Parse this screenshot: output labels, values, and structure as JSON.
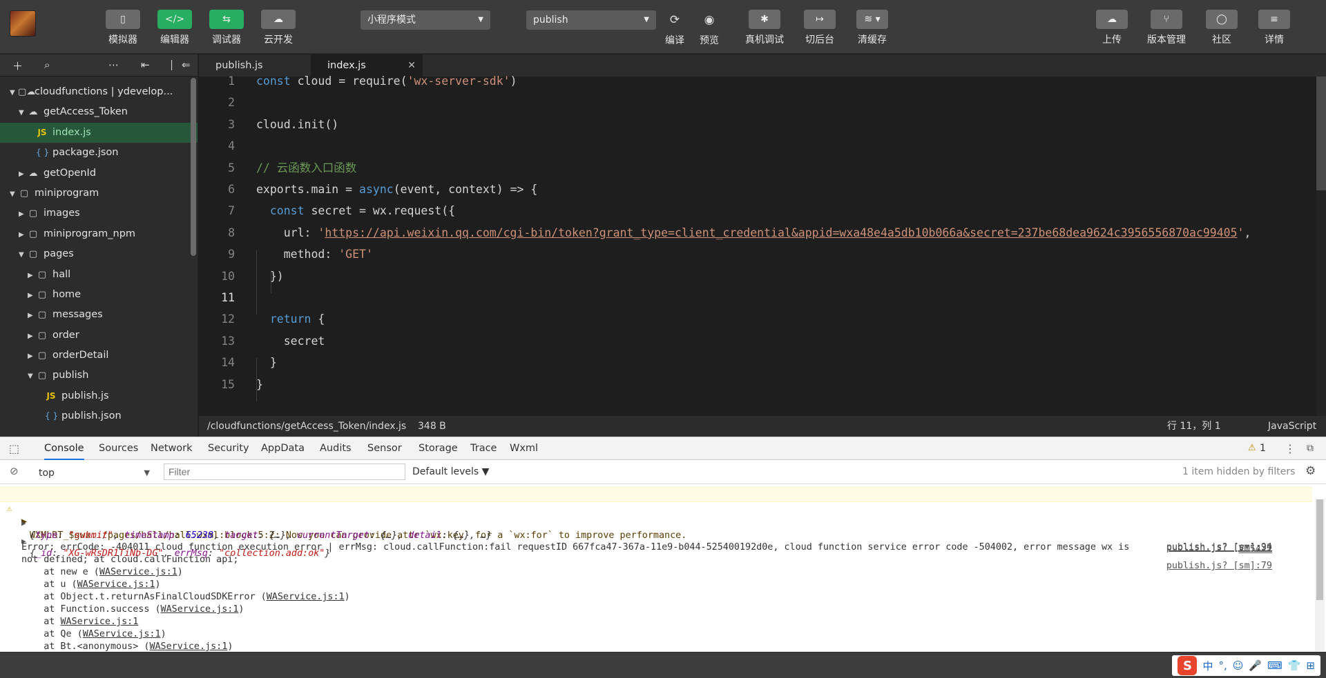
{
  "toolbar": {
    "left_buttons": [
      {
        "label": "模拟器",
        "icon": "phone-icon"
      },
      {
        "label": "编辑器",
        "icon": "code-icon"
      },
      {
        "label": "调试器",
        "icon": "debug-icon"
      },
      {
        "label": "云开发",
        "icon": "cloud-dev-icon"
      }
    ],
    "mode_select": "小程序模式",
    "compile_select": "publish",
    "action_buttons": [
      {
        "label": "编译",
        "icon": "refresh-icon"
      },
      {
        "label": "预览",
        "icon": "eye-icon"
      },
      {
        "label": "真机调试",
        "icon": "bug-icon"
      },
      {
        "label": "切后台",
        "icon": "switch-icon"
      },
      {
        "label": "清缓存",
        "icon": "layers-icon"
      }
    ],
    "right_buttons": [
      {
        "label": "上传",
        "icon": "upload-cloud-icon"
      },
      {
        "label": "版本管理",
        "icon": "branch-icon"
      },
      {
        "label": "社区",
        "icon": "chat-icon"
      },
      {
        "label": "详情",
        "icon": "menu-icon"
      }
    ]
  },
  "explorer": {
    "tree": [
      {
        "label": "cloudfunctions | ydevelop...",
        "type": "cloud-root",
        "depth": 0,
        "arrow": "▼"
      },
      {
        "label": "getAccess_Token",
        "type": "cloud",
        "depth": 1,
        "arrow": "▼"
      },
      {
        "label": "index.js",
        "type": "js",
        "depth": 2,
        "arrow": "",
        "active": true
      },
      {
        "label": "package.json",
        "type": "json",
        "depth": 2,
        "arrow": ""
      },
      {
        "label": "getOpenId",
        "type": "cloud",
        "depth": 1,
        "arrow": "▶"
      },
      {
        "label": "miniprogram",
        "type": "folder",
        "depth": 0,
        "arrow": "▼"
      },
      {
        "label": "images",
        "type": "folder",
        "depth": 1,
        "arrow": "▶"
      },
      {
        "label": "miniprogram_npm",
        "type": "folder",
        "depth": 1,
        "arrow": "▶"
      },
      {
        "label": "pages",
        "type": "folder",
        "depth": 1,
        "arrow": "▼"
      },
      {
        "label": "hall",
        "type": "folder",
        "depth": 2,
        "arrow": "▶"
      },
      {
        "label": "home",
        "type": "folder",
        "depth": 2,
        "arrow": "▶"
      },
      {
        "label": "messages",
        "type": "folder",
        "depth": 2,
        "arrow": "▶"
      },
      {
        "label": "order",
        "type": "folder",
        "depth": 2,
        "arrow": "▶"
      },
      {
        "label": "orderDetail",
        "type": "folder",
        "depth": 2,
        "arrow": "▶"
      },
      {
        "label": "publish",
        "type": "folder",
        "depth": 2,
        "arrow": "▼"
      },
      {
        "label": "publish.js",
        "type": "js",
        "depth": 3,
        "arrow": ""
      },
      {
        "label": "publish.json",
        "type": "json",
        "depth": 3,
        "arrow": ""
      }
    ]
  },
  "tabs": [
    {
      "label": "publish.js",
      "active": false
    },
    {
      "label": "index.js",
      "active": true,
      "close": "✕"
    }
  ],
  "editor": {
    "current_line": 11,
    "lines": [
      {
        "n": "1",
        "html": "<span class=\"kw\">const</span> cloud = require(<span class=\"str\">'wx-server-sdk'</span>)"
      },
      {
        "n": "2",
        "html": ""
      },
      {
        "n": "3",
        "html": "cloud.init()"
      },
      {
        "n": "4",
        "html": ""
      },
      {
        "n": "5",
        "html": "<span class=\"cm\">// 云函数入口函数</span>"
      },
      {
        "n": "6",
        "html": "exports.main = <span class=\"kw\">async</span>(event, context) =&gt; {"
      },
      {
        "n": "7",
        "html": "  <span class=\"kw\">const</span> secret = wx.request({"
      },
      {
        "n": "8",
        "html": "    url: <span class=\"str\">'</span><span class=\"url\">https://api.weixin.qq.com/cgi-bin/token?grant_type=client_credential&amp;appid=wxa48e4a5db10b066a&amp;secret=237be68dea9624c3956556870ac99405</span><span class=\"str\">'</span>,"
      },
      {
        "n": "9",
        "html": "    method: <span class=\"str\">'GET'</span>"
      },
      {
        "n": "10",
        "html": "  })"
      },
      {
        "n": "11",
        "html": ""
      },
      {
        "n": "12",
        "html": "  <span class=\"kw\">return</span> {"
      },
      {
        "n": "13",
        "html": "    secret"
      },
      {
        "n": "14",
        "html": "  }"
      },
      {
        "n": "15",
        "html": "}"
      }
    ]
  },
  "status": {
    "path": "/cloudfunctions/getAccess_Token/index.js",
    "size": "348 B",
    "position": "行 11，列 1",
    "language": "JavaScript"
  },
  "devtools": {
    "tabs": [
      "Console",
      "Sources",
      "Network",
      "Security",
      "AppData",
      "Audits",
      "Sensor",
      "Storage",
      "Trace",
      "Wxml"
    ],
    "active_tab": "Console",
    "warn_count": "1",
    "context": "top",
    "filter_placeholder": "Filter",
    "levels": "Default levels ▼",
    "hidden_note": "1 item hidden by filters"
  },
  "console": {
    "warning": {
      "text": "WXMLRT_$gwx:./pages/hall/hall.wxml:block:5:2: Now you can provide attr `wx:key` for a `wx:for` to improve performance.",
      "source": "VM54:1"
    },
    "obj1": {
      "source": "publish.js? [sm]:39"
    },
    "obj2": {
      "source": "publish.js? [sm]:79"
    },
    "error": {
      "line1": "Error: errCode: -404011 cloud function execution error | errMsg: cloud.callFunction:fail requestID 667fca47-367a-11e9-b044-525400192d0e, cloud function service error code -504002, error message wx is",
      "line2": "not defined; at cloud.callFunction api;",
      "source": "publish.js? [sm]:94",
      "stack": [
        {
          "pre": "    at new e (",
          "link": "WAService.js:1",
          "post": ")"
        },
        {
          "pre": "    at u (",
          "link": "WAService.js:1",
          "post": ")"
        },
        {
          "pre": "    at Object.t.returnAsFinalCloudSDKError (",
          "link": "WAService.js:1",
          "post": ")"
        },
        {
          "pre": "    at Function.success (",
          "link": "WAService.js:1",
          "post": ")"
        },
        {
          "pre": "    at ",
          "link": "WAService.js:1",
          "post": ""
        },
        {
          "pre": "    at Qe (",
          "link": "WAService.js:1",
          "post": ")"
        },
        {
          "pre": "    at Bt.<anonymous> (",
          "link": "WAService.js:1",
          "post": ")"
        }
      ]
    }
  },
  "ime": {
    "logo": "S",
    "items": [
      "中",
      "°,",
      "☺",
      "🎤",
      "⌨",
      "👕",
      "⊞"
    ]
  }
}
